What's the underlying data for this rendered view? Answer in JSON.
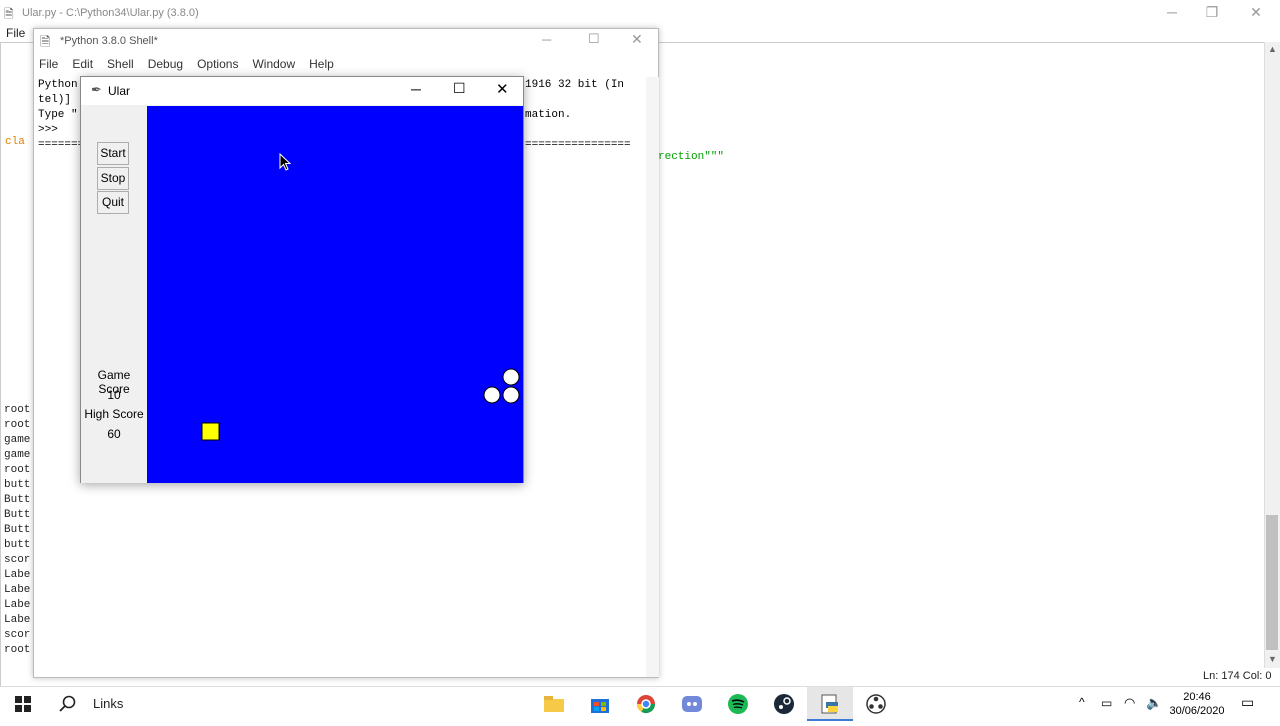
{
  "editor": {
    "title": "Ular.py - C:\\Python34\\Ular.py (3.8.0)",
    "menu_file": "File",
    "class_fragment": "cla",
    "string_fragment": "rection\"\"\"",
    "side_code_lines": [
      "root",
      "root",
      "game",
      "game",
      "root",
      "butt",
      "Butt",
      "Butt",
      "Butt",
      "butt",
      "scor",
      "Labe",
      "Labe",
      "Labe",
      "Labe",
      "scor",
      "root"
    ],
    "status": "Ln: 174   Col: 0"
  },
  "shell": {
    "title": "*Python 3.8.0 Shell*",
    "menu": [
      "File",
      "Edit",
      "Shell",
      "Debug",
      "Options",
      "Window",
      "Help"
    ],
    "lines_left": [
      "Python",
      "tel)]",
      "Type \"",
      ">>>",
      "======="
    ],
    "lines_right": [
      "1916 32 bit (In",
      "",
      "mation.",
      "",
      "================"
    ]
  },
  "ular": {
    "title": "Ular",
    "buttons": {
      "start": "Start",
      "stop": "Stop",
      "quit": "Quit"
    },
    "game_score_label": "Game Score",
    "game_score": "10",
    "high_score_label": "High Score",
    "high_score": "60"
  },
  "game_state": {
    "food_color": "#ffff00",
    "canvas_color": "#0000ff",
    "snake_color": "#ffffff"
  },
  "taskbar": {
    "search_label": "Links",
    "time": "20:46",
    "date": "30/06/2020"
  }
}
